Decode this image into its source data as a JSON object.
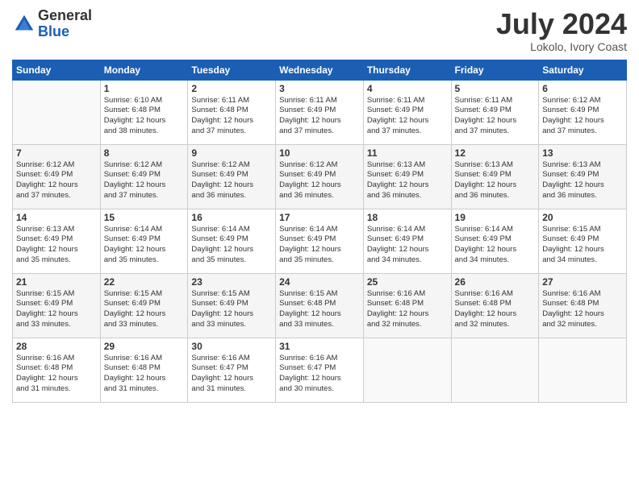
{
  "logo": {
    "general": "General",
    "blue": "Blue"
  },
  "title": {
    "month_year": "July 2024",
    "location": "Lokolo, Ivory Coast"
  },
  "days_of_week": [
    "Sunday",
    "Monday",
    "Tuesday",
    "Wednesday",
    "Thursday",
    "Friday",
    "Saturday"
  ],
  "weeks": [
    [
      {
        "date": "",
        "sunrise": "",
        "sunset": "",
        "daylight": ""
      },
      {
        "date": "1",
        "sunrise": "Sunrise: 6:10 AM",
        "sunset": "Sunset: 6:48 PM",
        "daylight": "Daylight: 12 hours and 38 minutes."
      },
      {
        "date": "2",
        "sunrise": "Sunrise: 6:11 AM",
        "sunset": "Sunset: 6:48 PM",
        "daylight": "Daylight: 12 hours and 37 minutes."
      },
      {
        "date": "3",
        "sunrise": "Sunrise: 6:11 AM",
        "sunset": "Sunset: 6:49 PM",
        "daylight": "Daylight: 12 hours and 37 minutes."
      },
      {
        "date": "4",
        "sunrise": "Sunrise: 6:11 AM",
        "sunset": "Sunset: 6:49 PM",
        "daylight": "Daylight: 12 hours and 37 minutes."
      },
      {
        "date": "5",
        "sunrise": "Sunrise: 6:11 AM",
        "sunset": "Sunset: 6:49 PM",
        "daylight": "Daylight: 12 hours and 37 minutes."
      },
      {
        "date": "6",
        "sunrise": "Sunrise: 6:12 AM",
        "sunset": "Sunset: 6:49 PM",
        "daylight": "Daylight: 12 hours and 37 minutes."
      }
    ],
    [
      {
        "date": "7",
        "sunrise": "Sunrise: 6:12 AM",
        "sunset": "Sunset: 6:49 PM",
        "daylight": "Daylight: 12 hours and 37 minutes."
      },
      {
        "date": "8",
        "sunrise": "Sunrise: 6:12 AM",
        "sunset": "Sunset: 6:49 PM",
        "daylight": "Daylight: 12 hours and 37 minutes."
      },
      {
        "date": "9",
        "sunrise": "Sunrise: 6:12 AM",
        "sunset": "Sunset: 6:49 PM",
        "daylight": "Daylight: 12 hours and 36 minutes."
      },
      {
        "date": "10",
        "sunrise": "Sunrise: 6:12 AM",
        "sunset": "Sunset: 6:49 PM",
        "daylight": "Daylight: 12 hours and 36 minutes."
      },
      {
        "date": "11",
        "sunrise": "Sunrise: 6:13 AM",
        "sunset": "Sunset: 6:49 PM",
        "daylight": "Daylight: 12 hours and 36 minutes."
      },
      {
        "date": "12",
        "sunrise": "Sunrise: 6:13 AM",
        "sunset": "Sunset: 6:49 PM",
        "daylight": "Daylight: 12 hours and 36 minutes."
      },
      {
        "date": "13",
        "sunrise": "Sunrise: 6:13 AM",
        "sunset": "Sunset: 6:49 PM",
        "daylight": "Daylight: 12 hours and 36 minutes."
      }
    ],
    [
      {
        "date": "14",
        "sunrise": "Sunrise: 6:13 AM",
        "sunset": "Sunset: 6:49 PM",
        "daylight": "Daylight: 12 hours and 35 minutes."
      },
      {
        "date": "15",
        "sunrise": "Sunrise: 6:14 AM",
        "sunset": "Sunset: 6:49 PM",
        "daylight": "Daylight: 12 hours and 35 minutes."
      },
      {
        "date": "16",
        "sunrise": "Sunrise: 6:14 AM",
        "sunset": "Sunset: 6:49 PM",
        "daylight": "Daylight: 12 hours and 35 minutes."
      },
      {
        "date": "17",
        "sunrise": "Sunrise: 6:14 AM",
        "sunset": "Sunset: 6:49 PM",
        "daylight": "Daylight: 12 hours and 35 minutes."
      },
      {
        "date": "18",
        "sunrise": "Sunrise: 6:14 AM",
        "sunset": "Sunset: 6:49 PM",
        "daylight": "Daylight: 12 hours and 34 minutes."
      },
      {
        "date": "19",
        "sunrise": "Sunrise: 6:14 AM",
        "sunset": "Sunset: 6:49 PM",
        "daylight": "Daylight: 12 hours and 34 minutes."
      },
      {
        "date": "20",
        "sunrise": "Sunrise: 6:15 AM",
        "sunset": "Sunset: 6:49 PM",
        "daylight": "Daylight: 12 hours and 34 minutes."
      }
    ],
    [
      {
        "date": "21",
        "sunrise": "Sunrise: 6:15 AM",
        "sunset": "Sunset: 6:49 PM",
        "daylight": "Daylight: 12 hours and 33 minutes."
      },
      {
        "date": "22",
        "sunrise": "Sunrise: 6:15 AM",
        "sunset": "Sunset: 6:49 PM",
        "daylight": "Daylight: 12 hours and 33 minutes."
      },
      {
        "date": "23",
        "sunrise": "Sunrise: 6:15 AM",
        "sunset": "Sunset: 6:49 PM",
        "daylight": "Daylight: 12 hours and 33 minutes."
      },
      {
        "date": "24",
        "sunrise": "Sunrise: 6:15 AM",
        "sunset": "Sunset: 6:48 PM",
        "daylight": "Daylight: 12 hours and 33 minutes."
      },
      {
        "date": "25",
        "sunrise": "Sunrise: 6:16 AM",
        "sunset": "Sunset: 6:48 PM",
        "daylight": "Daylight: 12 hours and 32 minutes."
      },
      {
        "date": "26",
        "sunrise": "Sunrise: 6:16 AM",
        "sunset": "Sunset: 6:48 PM",
        "daylight": "Daylight: 12 hours and 32 minutes."
      },
      {
        "date": "27",
        "sunrise": "Sunrise: 6:16 AM",
        "sunset": "Sunset: 6:48 PM",
        "daylight": "Daylight: 12 hours and 32 minutes."
      }
    ],
    [
      {
        "date": "28",
        "sunrise": "Sunrise: 6:16 AM",
        "sunset": "Sunset: 6:48 PM",
        "daylight": "Daylight: 12 hours and 31 minutes."
      },
      {
        "date": "29",
        "sunrise": "Sunrise: 6:16 AM",
        "sunset": "Sunset: 6:48 PM",
        "daylight": "Daylight: 12 hours and 31 minutes."
      },
      {
        "date": "30",
        "sunrise": "Sunrise: 6:16 AM",
        "sunset": "Sunset: 6:47 PM",
        "daylight": "Daylight: 12 hours and 31 minutes."
      },
      {
        "date": "31",
        "sunrise": "Sunrise: 6:16 AM",
        "sunset": "Sunset: 6:47 PM",
        "daylight": "Daylight: 12 hours and 30 minutes."
      },
      {
        "date": "",
        "sunrise": "",
        "sunset": "",
        "daylight": ""
      },
      {
        "date": "",
        "sunrise": "",
        "sunset": "",
        "daylight": ""
      },
      {
        "date": "",
        "sunrise": "",
        "sunset": "",
        "daylight": ""
      }
    ]
  ]
}
